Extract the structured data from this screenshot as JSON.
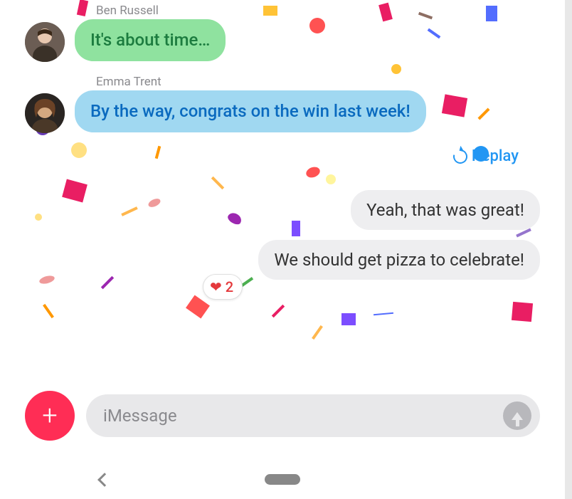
{
  "messages": [
    {
      "sender": "Ben Russell",
      "text": "It's about time…",
      "style": "green"
    },
    {
      "sender": "Emma Trent",
      "text": "By the way, congrats on the win last week!",
      "style": "blue"
    }
  ],
  "replay_label": "Replay",
  "sent_messages": [
    "Yeah, that was great!",
    "We should get pizza to celebrate!"
  ],
  "reaction": {
    "icon": "heart",
    "count": "2"
  },
  "compose": {
    "placeholder": "iMessage"
  },
  "icons": {
    "plus": "plus-icon",
    "send": "arrow-up-icon",
    "replay": "replay-icon",
    "back": "chevron-left-icon"
  },
  "colors": {
    "accent_red": "#ff2d55",
    "link_blue": "#2296f3",
    "heart": "#e4393c"
  }
}
